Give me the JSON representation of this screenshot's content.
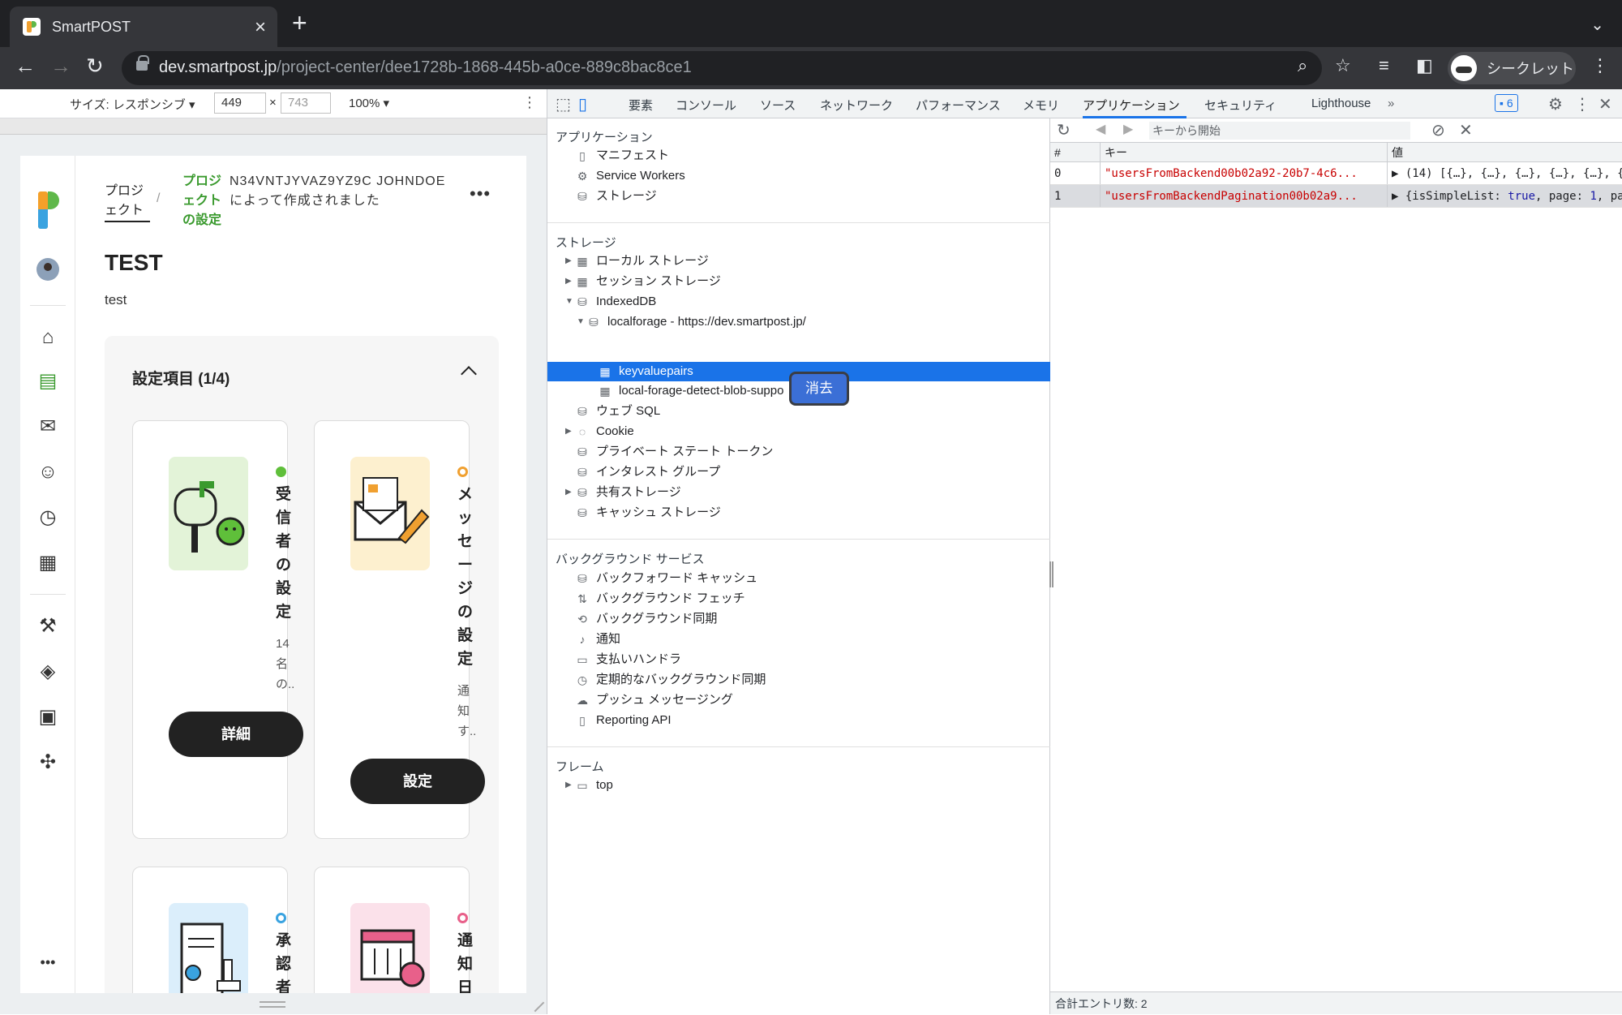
{
  "browser": {
    "tab_title": "SmartPOST",
    "url_host": "dev.smartpost.jp",
    "url_path": "/project-center/dee1728b-1868-445b-a0ce-889c8bac8ce1",
    "profile_label": "シークレット"
  },
  "device_toolbar": {
    "size_label": "サイズ: レスポンシブ ▾",
    "width": "449",
    "height": "743",
    "times": "×",
    "zoom": "100% ▾"
  },
  "page": {
    "breadcrumb_project": "プロジェクト",
    "breadcrumb_settings": "プロジェクトの設定",
    "breadcrumb_sep": "/",
    "created_by": "N34VNTJYVAZ9YZ9C JOHNDOE によって作成されました",
    "title": "TEST",
    "description": "test",
    "panel_title": "設定項目 (1/4)",
    "cards": [
      {
        "title": "受信者の設定",
        "sub": "14名の..",
        "button": "詳細",
        "status": "done"
      },
      {
        "title": "メッセージの設定",
        "sub": "通知す..",
        "button": "設定",
        "status": "todo"
      },
      {
        "title": "承認者",
        "status": "todo"
      },
      {
        "title": "通知日",
        "status": "todo"
      }
    ],
    "more": "•••"
  },
  "devtools": {
    "tabs": [
      "要素",
      "コンソール",
      "ソース",
      "ネットワーク",
      "パフォーマンス",
      "メモリ",
      "アプリケーション",
      "セキュリティ",
      "Lighthouse"
    ],
    "issues_count": "6",
    "sections": {
      "application": "アプリケーション",
      "storage": "ストレージ",
      "background": "バックグラウンド サービス",
      "frames": "フレーム"
    },
    "application_items": [
      "マニフェスト",
      "Service Workers",
      "ストレージ"
    ],
    "storage_items": {
      "local": "ローカル ストレージ",
      "session": "セッション ストレージ",
      "indexeddb": "IndexedDB",
      "localforage": "localforage - https://dev.smartpost.jp/",
      "keyvaluepairs": "keyvaluepairs",
      "detect": "local-forage-detect-blob-suppo",
      "websql": "ウェブ SQL",
      "cookie": "Cookie",
      "private_state": "プライベート ステート トークン",
      "interest": "インタレスト グループ",
      "shared": "共有ストレージ",
      "cache": "キャッシュ ストレージ"
    },
    "background_items": [
      "バックフォワード キャッシュ",
      "バックグラウンド フェッチ",
      "バックグラウンド同期",
      "通知",
      "支払いハンドラ",
      "定期的なバックグラウンド同期",
      "プッシュ メッセージング",
      "Reporting API"
    ],
    "frame_items": [
      "top"
    ],
    "tooltip": "消去",
    "filter_placeholder": "キーから開始",
    "grid": {
      "headers": [
        "#",
        "キー",
        "値"
      ],
      "rows": [
        {
          "index": "0",
          "key": "\"usersFromBackend00b02a92-20b7-4c6...",
          "value": "(14) [{…}, {…}, {…}, {…}, {…}, {…}"
        },
        {
          "index": "1",
          "key": "\"usersFromBackendPagination00b02a9...",
          "value_pre": "{isSimpleList: ",
          "value_kw": "true",
          "value_post": ", page: ",
          "value_num": "1",
          "value_tail": ", page"
        }
      ]
    },
    "footer": "合計エントリ数: 2"
  },
  "colors": {
    "accent": "#1a73e8",
    "brand_green": "#3a9a2e",
    "status_green": "#5fbf3a",
    "status_orange": "#f0a030"
  }
}
